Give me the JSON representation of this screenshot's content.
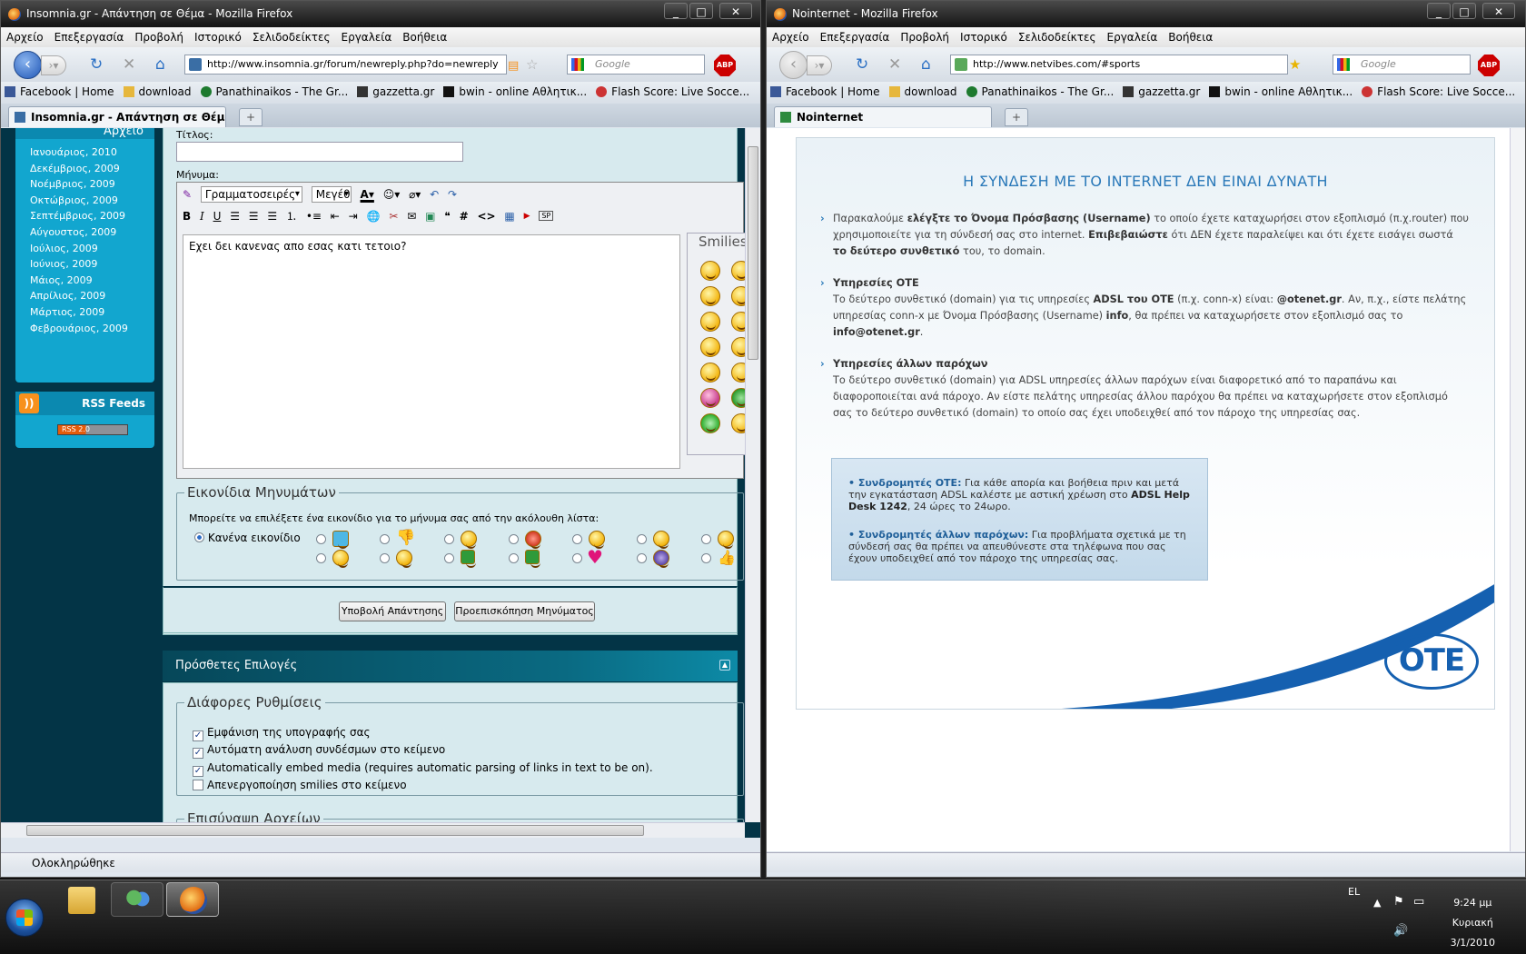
{
  "left_window": {
    "title": "Insomnia.gr - Απάντηση σε Θέμα - Mozilla Firefox",
    "menu": [
      "Αρχείο",
      "Επεξεργασία",
      "Προβολή",
      "Ιστορικό",
      "Σελιδοδείκτες",
      "Εργαλεία",
      "Βοήθεια"
    ],
    "url": "http://www.insomnia.gr/forum/newreply.php?do=newreply",
    "search_placeholder": "Google",
    "bookmarks": [
      "Facebook | Home",
      "download",
      "Panathinaikos - The Gr...",
      "gazzetta.gr",
      "bwin - online Αθλητικ...",
      "Flash Score: Live Socce..."
    ],
    "tab_label": "Insomnia.gr - Απάντηση σε Θέμα",
    "status": "Ολοκληρώθηκε",
    "sidebar": {
      "archive_title": "Αρχείο",
      "months": [
        "Ιανουάριος, 2010",
        "Δεκέμβριος, 2009",
        "Νοέμβριος, 2009",
        "Οκτώβριος, 2009",
        "Σεπτέμβριος, 2009",
        "Αύγουστος, 2009",
        "Ιούλιος, 2009",
        "Ιούνιος, 2009",
        "Μάιος, 2009",
        "Απρίλιος, 2009",
        "Μάρτιος, 2009",
        "Φεβρουάριος, 2009"
      ],
      "rss_title": "RSS Feeds",
      "rss_badge": "RSS 2.0"
    },
    "form": {
      "title_label": "Τίτλος:",
      "message_label": "Μήνυμα:",
      "font_select": "Γραμματοσειρές",
      "size_select": "Μεγέθ",
      "message_text": "Εχει δει κανενας απο εσας κατι τετοιο?",
      "smilies_title": "Smilies",
      "icons_legend": "Εικονίδια Μηνυμάτων",
      "icons_desc": "Μπορείτε να επιλέξετε ένα εικονίδιο για το μήνυμα σας από την ακόλουθη λίστα:",
      "no_icon": "Κανένα εικονίδιο",
      "submit_btn": "Υποβολή Απάντησης",
      "preview_btn": "Προεπισκόπηση Μηνύματος",
      "extra_options": "Πρόσθετες Επιλογές",
      "misc_legend": "Διάφορες Ρυθμίσεις",
      "options": [
        {
          "label": "Εμφάνιση της υπογραφής σας",
          "checked": true
        },
        {
          "label": "Αυτόματη ανάλυση συνδέσμων στο κείμενο",
          "checked": true
        },
        {
          "label": "Automatically embed media (requires automatic parsing of links in text to be on).",
          "checked": true
        },
        {
          "label": "Απενεργοποίηση smilies στο κείμενο",
          "checked": false
        }
      ],
      "attach_legend": "Επισύναψη Αρχείων"
    }
  },
  "right_window": {
    "title": "Nointernet - Mozilla Firefox",
    "menu": [
      "Αρχείο",
      "Επεξεργασία",
      "Προβολή",
      "Ιστορικό",
      "Σελιδοδείκτες",
      "Εργαλεία",
      "Βοήθεια"
    ],
    "url": "http://www.netvibes.com/#sports",
    "search_placeholder": "Google",
    "bookmarks": [
      "Facebook | Home",
      "download",
      "Panathinaikos - The Gr...",
      "gazzetta.gr",
      "bwin - online Αθλητικ...",
      "Flash Score: Live Socce..."
    ],
    "tab_label": "Nointernet",
    "page": {
      "heading": "Η ΣΥΝΔΕΣΗ ΜΕ ΤΟ INTERNET ΔΕΝ ΕΙΝΑΙ ΔΥΝΑΤΗ",
      "p1_a": "Παρακαλούμε ",
      "p1_b": "ελέγξτε το Όνομα Πρόσβασης (Username)",
      "p1_c": " το οποίο έχετε καταχωρήσει στον εξοπλισμό (π.χ.router) που χρησιμοποιείτε για τη σύνδεσή σας στο internet. ",
      "p1_d": "Επιβεβαιώστε",
      "p1_e": " ότι ΔΕΝ έχετε παραλείψει και ότι έχετε εισάγει σωστά ",
      "p1_f": "το δεύτερο συνθετικό",
      "p1_g": " του, το domain.",
      "p2_title": "Υπηρεσίες ΟΤΕ",
      "p2_a": "Το δεύτερο συνθετικό (domain) για τις υπηρεσίες ",
      "p2_b": "ADSL του ΟΤΕ",
      "p2_c": " (π.χ. conn-x) είναι: ",
      "p2_d": "@otenet.gr",
      "p2_e": ". Αν, π.χ., είστε πελάτης υπηρεσίας conn-x με Όνομα Πρόσβασης (Username) ",
      "p2_f": "info",
      "p2_g": ", θα πρέπει να καταχωρήσετε στον εξοπλισμό σας το ",
      "p2_h": "info@otenet.gr",
      "p2_i": ".",
      "p3_title": "Υπηρεσίες άλλων παρόχων",
      "p3_text": "Το δεύτερο συνθετικό (domain) για ADSL υπηρεσίες άλλων παρόχων είναι διαφορετικό από το παραπάνω και διαφοροποιείται ανά πάροχο. Αν είστε πελάτης υπηρεσίας άλλου παρόχου θα πρέπει να καταχωρήσετε στον εξοπλισμό σας το δεύτερο συνθετικό (domain) το οποίο σας έχει υποδειχθεί από τον πάροχο της υπηρεσίας σας.",
      "box1_title": "• Συνδρομητές ΟΤΕ:",
      "box1_a": " Για κάθε απορία και βοήθεια πριν και μετά την εγκατάσταση ADSL καλέστε με αστική χρέωση στο ",
      "box1_b": "ADSL Help Desk 1242",
      "box1_c": ", 24 ώρες το 24ωρο.",
      "box2_title": "• Συνδρομητές άλλων παρόχων:",
      "box2_text": " Για προβλήματα σχετικά με τη σύνδεσή σας θα πρέπει να απευθύνεστε στα τηλέφωνα που σας έχουν υποδειχθεί από τον πάροχο της υπηρεσίας σας.",
      "logo": "ΟΤΕ"
    }
  },
  "taskbar": {
    "lang": "EL",
    "time": "9:24 μμ",
    "day": "Κυριακή",
    "date": "3/1/2010"
  },
  "colors": {
    "ote_blue": "#1560b0",
    "heading_blue": "#2a79b9",
    "sidebar_cyan": "#12a6cf",
    "forum_dark": "#033446"
  }
}
